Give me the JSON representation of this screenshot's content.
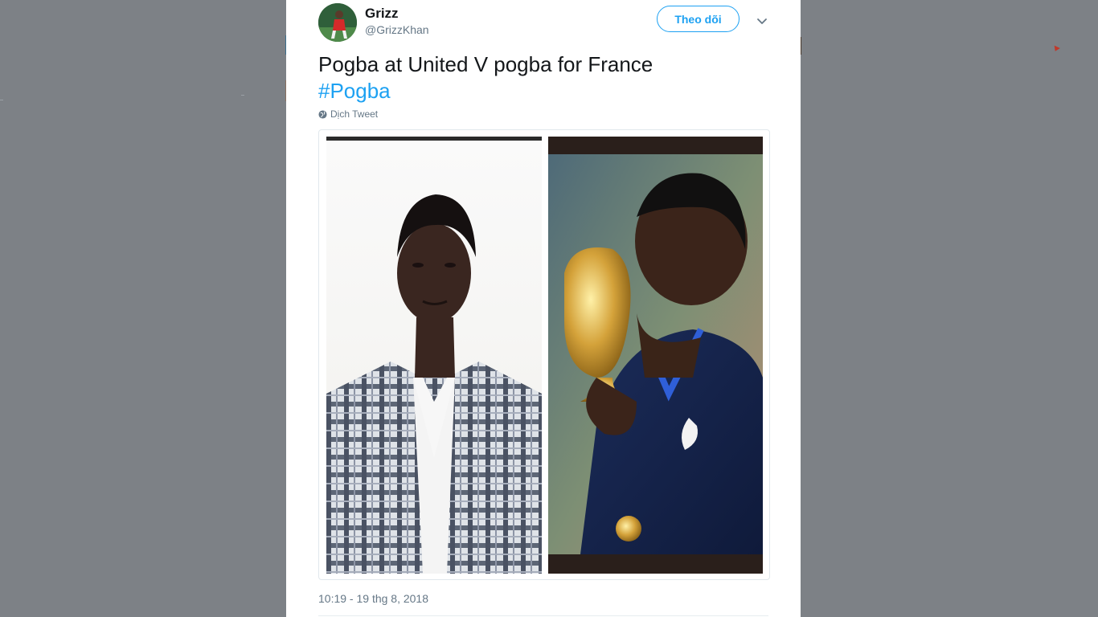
{
  "tweet": {
    "author": {
      "display_name": "Grizz",
      "handle": "@GrizzKhan",
      "avatar_icon": "avatar-image"
    },
    "follow_button_label": "Theo dõi",
    "menu_icon": "chevron-down-icon",
    "text_line_1": "Pogba at United V pogba for France",
    "hashtag": "#Pogba",
    "translate_label": "Dịch Tweet",
    "translate_icon": "globe-icon",
    "timestamp": "10:19 - 19 thg 8, 2018",
    "media": {
      "images": [
        {
          "alt": "man-in-checked-shirt-photo"
        },
        {
          "alt": "player-kissing-trophy-photo"
        }
      ]
    }
  },
  "colors": {
    "accent": "#1da1f2",
    "text": "#14171a",
    "secondary_text": "#657786",
    "overlay": "#7d8186"
  }
}
